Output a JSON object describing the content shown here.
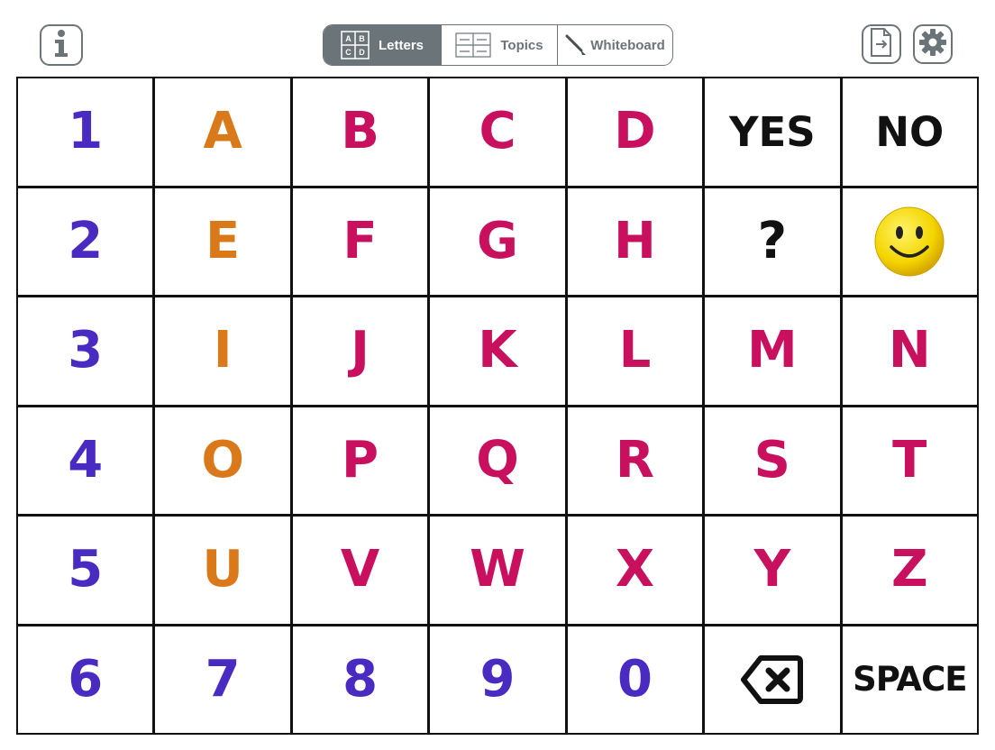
{
  "tabs": [
    {
      "label": "Letters"
    },
    {
      "label": "Topics"
    },
    {
      "label": "Whiteboard"
    }
  ],
  "letters_tab_icon": [
    "A",
    "B",
    "C",
    "D"
  ],
  "colors": {
    "number": "#4a2bc2",
    "vowel": "#d9791a",
    "consonant": "#c8105e",
    "word": "#111111",
    "chrome": "#6b7478",
    "smiley": "#f4d500"
  },
  "icons": {
    "info": "info-icon",
    "export": "export-icon",
    "settings": "gear-icon",
    "backspace": "backspace-icon",
    "smiley": "smiley-face-icon"
  },
  "grid": [
    [
      {
        "text": "1",
        "type": "number"
      },
      {
        "text": "A",
        "type": "vowel"
      },
      {
        "text": "B",
        "type": "consonant"
      },
      {
        "text": "C",
        "type": "consonant"
      },
      {
        "text": "D",
        "type": "consonant"
      },
      {
        "text": "YES",
        "type": "word"
      },
      {
        "text": "NO",
        "type": "word"
      }
    ],
    [
      {
        "text": "2",
        "type": "number"
      },
      {
        "text": "E",
        "type": "vowel"
      },
      {
        "text": "F",
        "type": "consonant"
      },
      {
        "text": "G",
        "type": "consonant"
      },
      {
        "text": "H",
        "type": "consonant"
      },
      {
        "text": "?",
        "type": "symbol"
      },
      {
        "text": "",
        "type": "smiley"
      }
    ],
    [
      {
        "text": "3",
        "type": "number"
      },
      {
        "text": "I",
        "type": "vowel"
      },
      {
        "text": "J",
        "type": "consonant"
      },
      {
        "text": "K",
        "type": "consonant"
      },
      {
        "text": "L",
        "type": "consonant"
      },
      {
        "text": "M",
        "type": "consonant"
      },
      {
        "text": "N",
        "type": "consonant"
      }
    ],
    [
      {
        "text": "4",
        "type": "number"
      },
      {
        "text": "O",
        "type": "vowel"
      },
      {
        "text": "P",
        "type": "consonant"
      },
      {
        "text": "Q",
        "type": "consonant"
      },
      {
        "text": "R",
        "type": "consonant"
      },
      {
        "text": "S",
        "type": "consonant"
      },
      {
        "text": "T",
        "type": "consonant"
      }
    ],
    [
      {
        "text": "5",
        "type": "number"
      },
      {
        "text": "U",
        "type": "vowel"
      },
      {
        "text": "V",
        "type": "consonant"
      },
      {
        "text": "W",
        "type": "consonant"
      },
      {
        "text": "X",
        "type": "consonant"
      },
      {
        "text": "Y",
        "type": "consonant"
      },
      {
        "text": "Z",
        "type": "consonant"
      }
    ],
    [
      {
        "text": "6",
        "type": "number"
      },
      {
        "text": "7",
        "type": "number"
      },
      {
        "text": "8",
        "type": "number"
      },
      {
        "text": "9",
        "type": "number"
      },
      {
        "text": "0",
        "type": "number"
      },
      {
        "text": "",
        "type": "backspace"
      },
      {
        "text": "SPACE",
        "type": "space"
      }
    ]
  ]
}
